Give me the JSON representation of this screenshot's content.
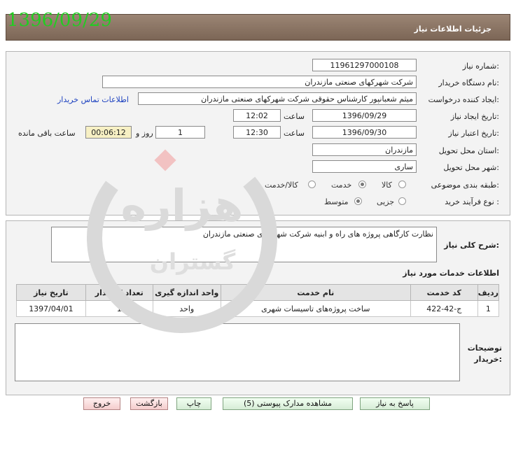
{
  "header": {
    "title": "جزئیات اطلاعات نیاز",
    "date_stamp": "1396/09/29"
  },
  "form": {
    "need_number": {
      "label": "شماره نیاز:",
      "value": "11961297000108"
    },
    "buyer_org": {
      "label": "نام دستگاه خریدار:",
      "value": "شرکت شهرکهای صنعتی مازندران"
    },
    "requester": {
      "label": "ایجاد کننده درخواست:",
      "value": "میثم شعبانپور کارشناس حقوقی شرکت شهرکهای صنعتی مازندران",
      "contact_link": "اطلاعات تماس خریدار"
    },
    "created": {
      "label": "تاریخ ایجاد نیاز:",
      "date": "1396/09/29",
      "time_label": "ساعت",
      "time": "12:02"
    },
    "validity": {
      "label": "تاریخ اعتبار نیاز:",
      "date": "1396/09/30",
      "time_label": "ساعت",
      "time": "12:30",
      "days": "1",
      "days_label": "روز و",
      "remaining": "00:06:12",
      "remaining_label": "ساعت باقی مانده"
    },
    "province": {
      "label": "استان محل تحویل:",
      "value": "مازندران"
    },
    "city": {
      "label": "شهر محل تحویل:",
      "value": "ساری"
    },
    "category": {
      "label": "طبقه بندی موضوعی:",
      "options": [
        "کالا",
        "خدمت",
        "کالا/خدمت"
      ],
      "selected": "خدمت"
    },
    "process": {
      "label": "نوع فرآیند خرید :",
      "options": [
        "جزیی",
        "متوسط"
      ],
      "selected": "متوسط"
    }
  },
  "summary": {
    "label": "شرح کلی نیاز:",
    "value": "نظارت کارگاهی پروژه های راه و ابنیه شرکت شهرکهای صنعتی مازندران"
  },
  "services": {
    "title": "اطلاعات خدمات مورد نیاز",
    "columns": [
      "ردیف",
      "کد خدمت",
      "نام خدمت",
      "واحد اندازه گیری",
      "تعداد / مقدار",
      "تاریخ نیاز"
    ],
    "rows": [
      {
        "row": "1",
        "code": "ج-42-422",
        "name": "ساخت پروژه‌های تاسیسات شهری",
        "unit": "واحد",
        "qty": "1",
        "date": "1397/04/01"
      }
    ]
  },
  "buyer_notes": {
    "label_line1": "توضیحات",
    "label_line2": "خریدار:",
    "value": ""
  },
  "buttons": {
    "reply": "پاسخ به نیاز",
    "attachments": "مشاهده مدارک پیوستی (5)",
    "print": "چاپ",
    "back": "بازگشت",
    "exit": "خروج"
  },
  "watermark": {
    "text": "هزاره",
    "subtext": "گستران"
  }
}
